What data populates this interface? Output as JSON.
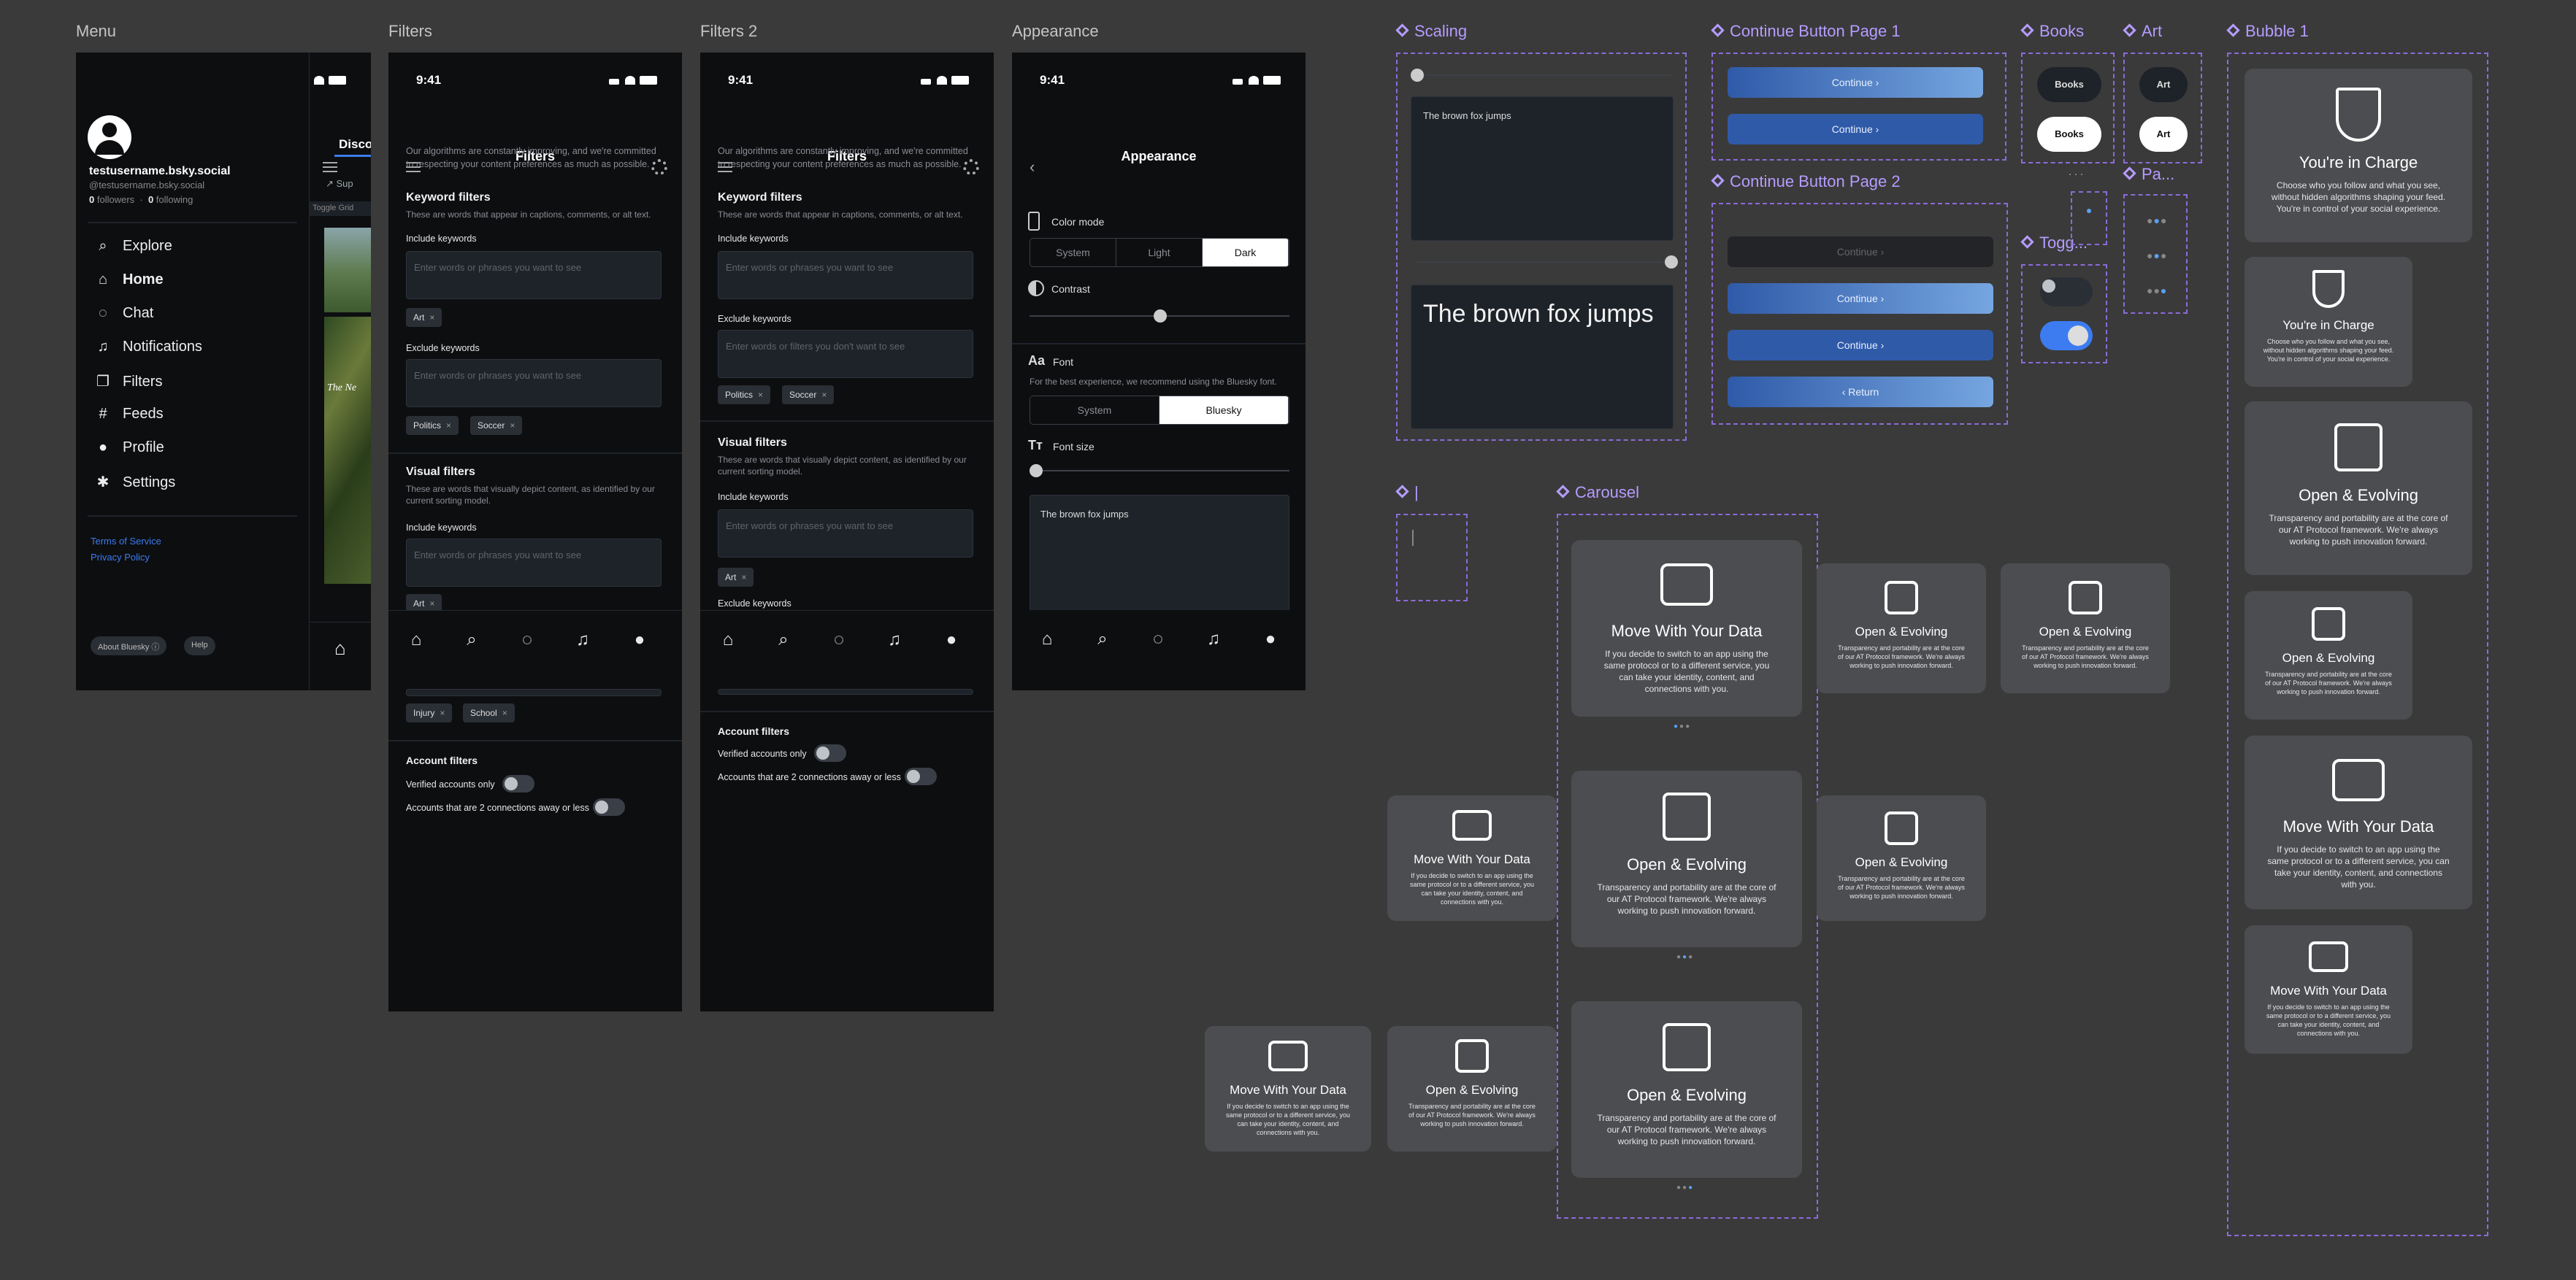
{
  "frames": {
    "menu": "Menu",
    "filters": "Filters",
    "filters2": "Filters 2",
    "appearance": "Appearance"
  },
  "components": {
    "scaling": "Scaling",
    "cont1": "Continue Button Page 1",
    "cont2": "Continue Button Page 2",
    "books": "Books",
    "art": "Art",
    "bubble": "Bubble 1",
    "pa": "Pa...",
    "togg": "Togg...",
    "bar": "|",
    "carousel": "Carousel"
  },
  "status_time": "9:41",
  "menu": {
    "username": "testusername.bsky.social",
    "handle": "@testusername.bsky.social",
    "followers_count": "0",
    "followers_label": "followers",
    "following_count": "0",
    "following_label": "following",
    "items": [
      "Explore",
      "Home",
      "Chat",
      "Notifications",
      "Filters",
      "Feeds",
      "Profile",
      "Settings"
    ],
    "terms": "Terms of Service",
    "privacy": "Privacy Policy",
    "about": "About Bluesky",
    "help": "Help",
    "peek_tab": "Disco",
    "peek_sup": "Sup",
    "peek_toggle": "Toggle Grid",
    "peek_news": "The Ne"
  },
  "filters": {
    "title": "Filters",
    "intro": "Our algorithms are constantly improving, and we're committed to respecting your content preferences as much as possible.",
    "keyword_title": "Keyword filters",
    "keyword_desc": "These are words that appear in captions, comments, or alt text.",
    "include": "Include keywords",
    "include_ph": "Enter words or phrases you want to see",
    "exclude": "Exclude keywords",
    "exclude_ph": "Enter words or filters you don't want to see",
    "chip_art": "Art",
    "chip_politics": "Politics",
    "chip_soccer": "Soccer",
    "chip_injury": "Injury",
    "chip_school": "School",
    "visual_title": "Visual filters",
    "visual_desc": "These are words that visually depict content, as identified by our current sorting model.",
    "account_title": "Account filters",
    "verified": "Verified accounts only",
    "connections": "Accounts that are 2 connections away or less",
    "x": "×"
  },
  "appearance": {
    "title": "Appearance",
    "color_mode": "Color mode",
    "modes": [
      "System",
      "Light",
      "Dark"
    ],
    "contrast": "Contrast",
    "font": "Font",
    "font_desc": "For the best experience, we recommend using the Bluesky font.",
    "fonts": [
      "System",
      "Bluesky"
    ],
    "font_size": "Font size",
    "sample": "The brown fox jumps"
  },
  "scaling": {
    "small": "The brown fox jumps",
    "large": "The brown fox jumps"
  },
  "buttons": {
    "continue": "Continue",
    "return": "Return",
    "books": "Books",
    "art": "Art"
  },
  "cards": {
    "charge_title": "You're in Charge",
    "charge_desc": "Choose who you follow and what you see, without hidden algorithms shaping your feed. You're in control of your social experience.",
    "open_title": "Open & Evolving",
    "open_desc": "Transparency and portability are at the core of our AT Protocol framework. We're always working to push innovation forward.",
    "move_title": "Move With Your Data",
    "move_desc": "If you decide to switch to an app using the same protocol or to a different service, you can take your identity, content, and connections with you."
  },
  "colors": {
    "accent": "#b59cff",
    "blue": "#3c7cf0",
    "bg": "#3a3a3a"
  }
}
